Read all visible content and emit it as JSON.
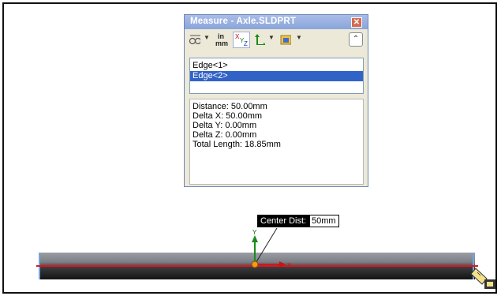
{
  "dialog": {
    "title": "Measure - Axle.SLDPRT",
    "close_label": "✕",
    "toolbar": {
      "units_top": "in",
      "units_bottom": "mm",
      "collapse_glyph": "⌃"
    },
    "selections": [
      {
        "label": "Edge<1>",
        "selected": false
      },
      {
        "label": "Edge<2>",
        "selected": true
      }
    ],
    "results": [
      "Distance: 50.00mm",
      "Delta X: 50.00mm",
      "Delta Y: 0.00mm",
      "Delta Z: 0.00mm",
      "Total Length: 18.85mm"
    ]
  },
  "viewport": {
    "callout_label": "Center Dist:",
    "callout_value": "50mm",
    "axis_labels": {
      "x": "X",
      "y": "Y"
    }
  },
  "colors": {
    "titlebar": "#8aa5da",
    "selection": "#3163c6",
    "measure_line": "#e0141c",
    "axle_top": "#8a8d93",
    "axle_bottom": "#1a1a1a"
  },
  "icons": [
    "tape-measure-icon",
    "units-icon",
    "xyz-delta-icon",
    "coordinate-system-icon",
    "projection-icon",
    "collapse-icon",
    "close-icon",
    "measure-cursor-icon"
  ]
}
